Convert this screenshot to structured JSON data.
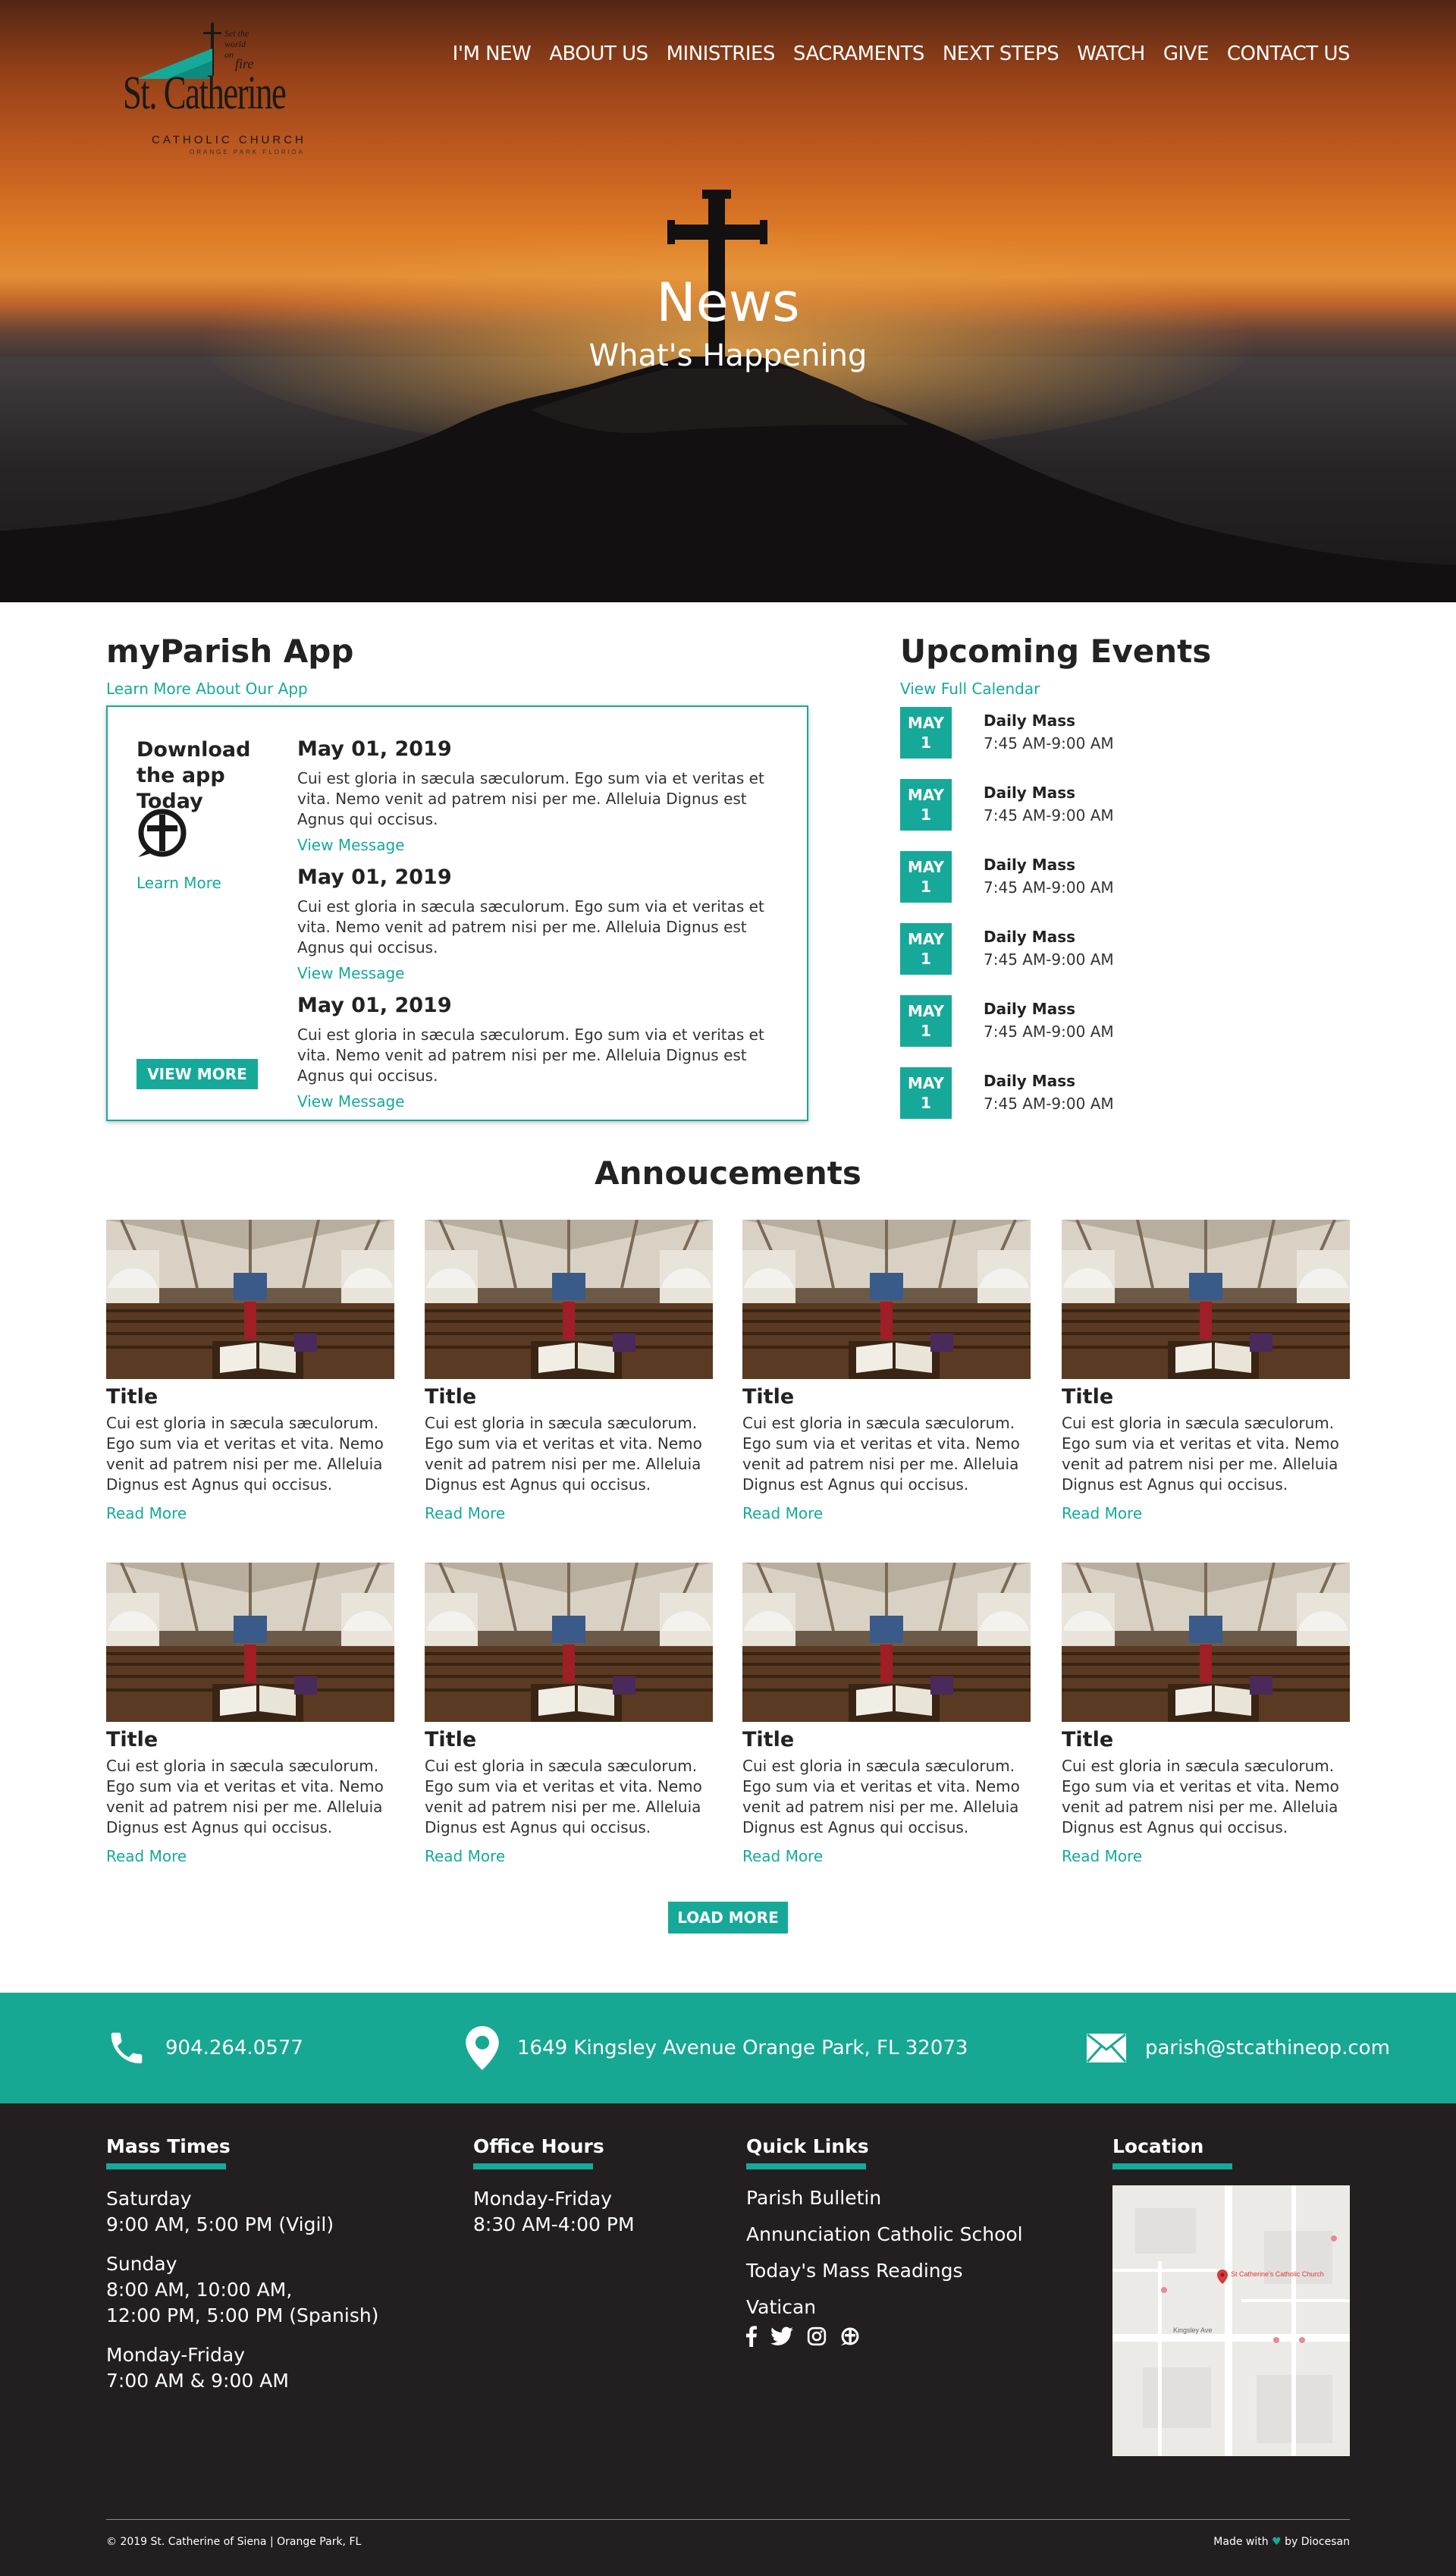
{
  "header": {
    "logo_name": "St. Catherine",
    "logo_sub": "CATHOLIC CHURCH",
    "logo_sub2": "ORANGE PARK FLORIDA",
    "nav": [
      "I'M NEW",
      "ABOUT US",
      "MINISTRIES",
      "SACRAMENTS",
      "NEXT STEPS",
      "WATCH",
      "GIVE",
      "CONTACT US"
    ]
  },
  "hero": {
    "title": "News",
    "subtitle": "What's Happening"
  },
  "app": {
    "title": "myParish App",
    "learn_link": "Learn More About Our App",
    "download_title": "Download the app Today",
    "download_learn": "Learn More",
    "view_more": "VIEW MORE",
    "messages": [
      {
        "date": "May 01, 2019",
        "text": "Cui est gloria in sæcula sæculorum. Ego sum via et veritas et vita. Nemo venit ad patrem nisi per me. Alleluia Dignus est Agnus qui occisus.",
        "link": "View Message"
      },
      {
        "date": "May 01, 2019",
        "text": "Cui est gloria in sæcula sæculorum. Ego sum via et veritas et vita. Nemo venit ad patrem nisi per me. Alleluia Dignus est Agnus qui occisus.",
        "link": "View Message"
      },
      {
        "date": "May 01, 2019",
        "text": "Cui est gloria in sæcula sæculorum. Ego sum via et veritas et vita. Nemo venit ad patrem nisi per me. Alleluia Dignus est Agnus qui occisus.",
        "link": "View Message"
      }
    ]
  },
  "events": {
    "title": "Upcoming Events",
    "calendar_link": "View Full Calendar",
    "items": [
      {
        "month": "MAY",
        "day": "1",
        "title": "Daily Mass",
        "time": "7:45 AM-9:00 AM"
      },
      {
        "month": "MAY",
        "day": "1",
        "title": "Daily Mass",
        "time": "7:45 AM-9:00 AM"
      },
      {
        "month": "MAY",
        "day": "1",
        "title": "Daily Mass",
        "time": "7:45 AM-9:00 AM"
      },
      {
        "month": "MAY",
        "day": "1",
        "title": "Daily Mass",
        "time": "7:45 AM-9:00 AM"
      },
      {
        "month": "MAY",
        "day": "1",
        "title": "Daily Mass",
        "time": "7:45 AM-9:00 AM"
      },
      {
        "month": "MAY",
        "day": "1",
        "title": "Daily Mass",
        "time": "7:45 AM-9:00 AM"
      }
    ]
  },
  "announcements": {
    "title": "Annoucements",
    "load_more": "LOAD MORE",
    "cards": [
      {
        "title": "Title",
        "text": "Cui est gloria in sæcula sæculorum. Ego sum via et veritas et vita. Nemo venit ad patrem nisi per me. Alleluia Dignus est Agnus qui occisus.",
        "link": "Read More"
      },
      {
        "title": "Title",
        "text": "Cui est gloria in sæcula sæculorum. Ego sum via et veritas et vita. Nemo venit ad patrem nisi per me. Alleluia Dignus est Agnus qui occisus.",
        "link": "Read More"
      },
      {
        "title": "Title",
        "text": "Cui est gloria in sæcula sæculorum. Ego sum via et veritas et vita. Nemo venit ad patrem nisi per me. Alleluia Dignus est Agnus qui occisus.",
        "link": "Read More"
      },
      {
        "title": "Title",
        "text": "Cui est gloria in sæcula sæculorum. Ego sum via et veritas et vita. Nemo venit ad patrem nisi per me. Alleluia Dignus est Agnus qui occisus.",
        "link": "Read More"
      },
      {
        "title": "Title",
        "text": "Cui est gloria in sæcula sæculorum. Ego sum via et veritas et vita. Nemo venit ad patrem nisi per me. Alleluia Dignus est Agnus qui occisus.",
        "link": "Read More"
      },
      {
        "title": "Title",
        "text": "Cui est gloria in sæcula sæculorum. Ego sum via et veritas et vita. Nemo venit ad patrem nisi per me. Alleluia Dignus est Agnus qui occisus.",
        "link": "Read More"
      },
      {
        "title": "Title",
        "text": "Cui est gloria in sæcula sæculorum. Ego sum via et veritas et vita. Nemo venit ad patrem nisi per me. Alleluia Dignus est Agnus qui occisus.",
        "link": "Read More"
      },
      {
        "title": "Title",
        "text": "Cui est gloria in sæcula sæculorum. Ego sum via et veritas et vita. Nemo venit ad patrem nisi per me. Alleluia Dignus est Agnus qui occisus.",
        "link": "Read More"
      }
    ]
  },
  "contact": {
    "phone": "904.264.0577",
    "address": "1649 Kingsley Avenue Orange Park, FL 32073",
    "email": "parish@stcathineop.com"
  },
  "footer": {
    "mass_title": "Mass Times",
    "mass_lines": [
      "Saturday",
      "9:00 AM, 5:00 PM (Vigil)",
      "Sunday",
      "8:00 AM, 10:00 AM,",
      "12:00 PM, 5:00 PM (Spanish)",
      "Monday-Friday",
      "7:00 AM & 9:00 AM"
    ],
    "office_title": "Office Hours",
    "office_lines": [
      "Monday-Friday",
      "8:30 AM-4:00 PM"
    ],
    "links_title": "Quick Links",
    "links": [
      "Parish Bulletin",
      "Annunciation Catholic School",
      "Today's Mass Readings",
      "Vatican"
    ],
    "location_title": "Location",
    "map_labels": {
      "church": "St Catherine's Catholic Church",
      "road": "Kingsley Ave"
    },
    "copyright": "© 2019 St. Catherine of Siena | Orange Park, FL",
    "made_with": "Made with",
    "made_by": "by Diocesan"
  },
  "colors": {
    "accent": "#16a99a",
    "contact_bar": "#17a894",
    "footer_bg": "#231f20"
  },
  "icons": [
    "phone-icon",
    "location-pin-icon",
    "envelope-icon",
    "facebook-icon",
    "twitter-icon",
    "instagram-icon",
    "myparish-icon",
    "heart-icon"
  ]
}
